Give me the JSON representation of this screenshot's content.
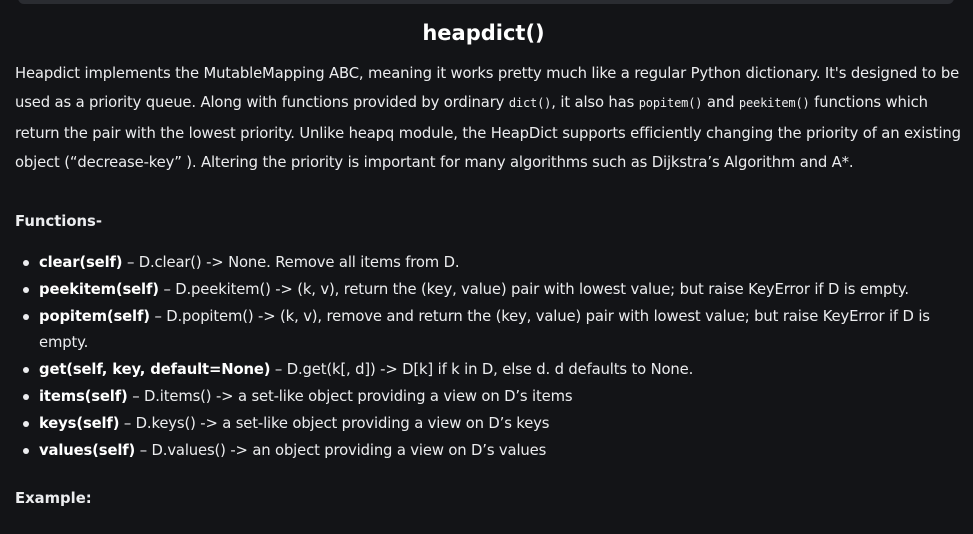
{
  "title": "heapdict()",
  "intro": {
    "t1": "Heapdict implements the MutableMapping ABC, meaning it works pretty much like a regular Python dictionary. It's designed to be used as a priority queue. Along with functions provided by ordinary ",
    "c1": "dict()",
    "t2": ", it also has ",
    "c2": "popitem()",
    "t3": " and ",
    "c3": "peekitem()",
    "t4": " functions which return the pair with the lowest priority. Unlike heapq module, the HeapDict supports efficiently changing the priority of an existing object (“decrease-key” ). Altering the priority is important for many algorithms such as Dijkstra’s Algorithm and A*."
  },
  "functions_heading": "Functions-",
  "functions": [
    {
      "name": "clear(self)",
      "desc": " – D.clear() -> None. Remove all items from D."
    },
    {
      "name": "peekitem(self)",
      "desc": " – D.peekitem() -> (k, v), return the (key, value) pair with lowest value; but raise KeyError if D is empty."
    },
    {
      "name": "popitem(self)",
      "desc": " – D.popitem() -> (k, v), remove and return the (key, value) pair with lowest value; but raise KeyError if D is empty."
    },
    {
      "name": "get(self, key, default=None)",
      "desc": " – D.get(k[, d]) -> D[k] if k in D, else d. d defaults to None."
    },
    {
      "name": "items(self)",
      "desc": " – D.items() -> a set-like object providing a view on D’s items"
    },
    {
      "name": "keys(self)",
      "desc": " – D.keys() -> a set-like object providing a view on D’s keys"
    },
    {
      "name": "values(self)",
      "desc": " – D.values() -> an object providing a view on D’s values"
    }
  ],
  "example_heading": "Example:"
}
